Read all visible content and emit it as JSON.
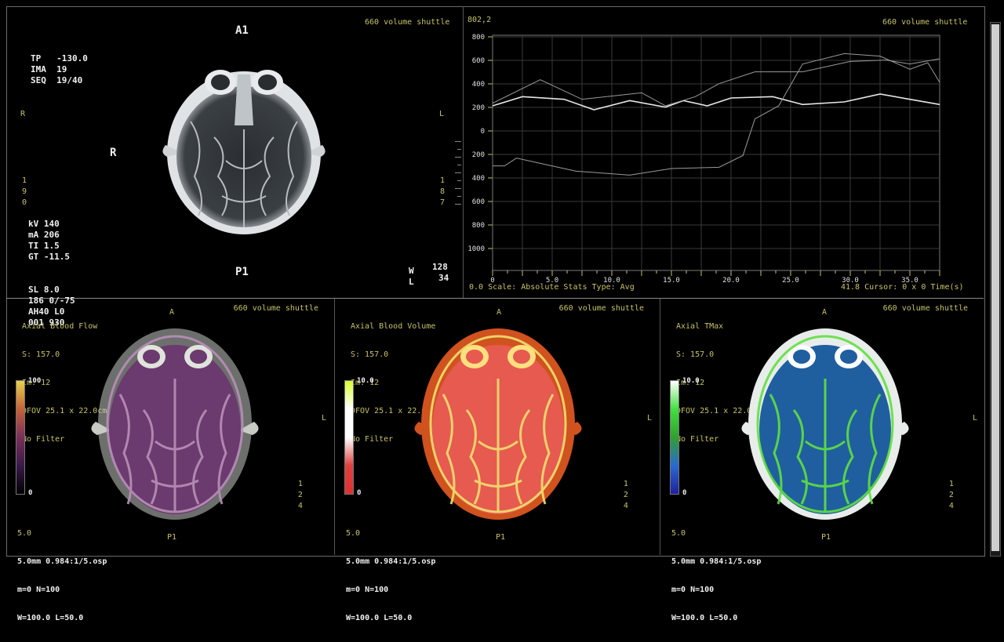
{
  "top_left": {
    "header": "660 volume shuttle",
    "view_top": "A1",
    "view_bottom": "P1",
    "side_r_small": "R",
    "side_r_big": "R",
    "side_l": "L",
    "left_numbers": [
      "1",
      "9",
      "0"
    ],
    "right_numbers": [
      "1",
      "8",
      "7"
    ],
    "info_top": [
      "TP   -130.0",
      "IMA  19",
      "SEQ  19/40"
    ],
    "info_bottom": [
      "kV 140",
      "mA 206",
      "TI 1.5",
      "GT -11.5",
      "SL 8.0",
      "186 0/-75",
      "AH40 L0",
      "001 930"
    ],
    "w_label": "W",
    "w_value": "128",
    "l_label": "L",
    "l_value": "34"
  },
  "graph": {
    "header": "660 volume shuttle",
    "corner": "802,2",
    "footer_left": "0.0 Scale: Absolute Stats Type: Avg",
    "footer_right": "41.8 Cursor: 0 x 0 Time(s)"
  },
  "chart_data": {
    "type": "line",
    "xlabel": "Time(s)",
    "x_ticks": [
      "0",
      "5.0",
      "10.0",
      "15.0",
      "20.0",
      "25.0",
      "30.0",
      "35.0"
    ],
    "y_ticks": [
      "800",
      "600",
      "400",
      "200",
      "0",
      "200",
      "400",
      "600",
      "800",
      "1000"
    ],
    "xlim": [
      0,
      37.5
    ],
    "ylim": [
      -1000,
      800
    ],
    "series": [
      {
        "values": [
          [
            0,
            260
          ],
          [
            2.5,
            330
          ],
          [
            6,
            310
          ],
          [
            8.5,
            230
          ],
          [
            11.5,
            300
          ],
          [
            14.5,
            250
          ],
          [
            16,
            300
          ],
          [
            18,
            260
          ],
          [
            20,
            320
          ],
          [
            23.5,
            330
          ],
          [
            26,
            270
          ],
          [
            29.5,
            290
          ],
          [
            32.5,
            350
          ],
          [
            35,
            310
          ],
          [
            37.5,
            270
          ]
        ]
      },
      {
        "values": [
          [
            0,
            280
          ],
          [
            4,
            460
          ],
          [
            7.5,
            310
          ],
          [
            12.5,
            360
          ],
          [
            14.5,
            260
          ],
          [
            17,
            330
          ],
          [
            19,
            430
          ],
          [
            22,
            520
          ],
          [
            26,
            520
          ],
          [
            30,
            600
          ],
          [
            33,
            610
          ],
          [
            35,
            580
          ],
          [
            37.5,
            620
          ]
        ]
      },
      {
        "values": [
          [
            0,
            -200
          ],
          [
            1,
            -200
          ],
          [
            2,
            -140
          ],
          [
            4,
            -180
          ],
          [
            7,
            -240
          ],
          [
            11.5,
            -270
          ],
          [
            15,
            -220
          ],
          [
            19,
            -210
          ],
          [
            21,
            -120
          ],
          [
            22,
            160
          ],
          [
            24,
            260
          ],
          [
            26,
            580
          ],
          [
            29.5,
            660
          ],
          [
            32.5,
            640
          ],
          [
            35,
            540
          ],
          [
            36.5,
            590
          ],
          [
            37.5,
            440
          ]
        ]
      }
    ]
  },
  "panels": [
    {
      "title": "Axial Blood Flow",
      "header": "660 volume shuttle",
      "s": "S: 157.0",
      "im": "Im: 12",
      "dfov": "DFOV 25.1 x 22.0cm",
      "filter": "No Filter",
      "scale_max": "100",
      "scale_min": "0",
      "top": "A",
      "bottom": "P1",
      "side": "L",
      "side_nums": [
        "1",
        "2",
        "4"
      ],
      "footer": [
        "5.0",
        "5.0mm 0.984:1/5.osp",
        "m=0 N=100",
        "W=100.0 L=50.0"
      ]
    },
    {
      "title": "Axial Blood Volume",
      "header": "660 volume shuttle",
      "s": "S: 157.0",
      "im": "Im: 12",
      "dfov": "DFOV 25.1 x 22.0cm",
      "filter": "No Filter",
      "scale_max": "10.0",
      "scale_min": "0",
      "top": "A",
      "bottom": "P1",
      "side": "L",
      "side_nums": [
        "1",
        "2",
        "4"
      ],
      "footer": [
        "5.0",
        "5.0mm 0.984:1/5.osp",
        "m=0 N=100",
        "W=100.0 L=50.0"
      ]
    },
    {
      "title": "Axial TMax",
      "header": "660 volume shuttle",
      "s": "S: 157.0",
      "im": "Im: 12",
      "dfov": "DFOV 25.1 x 22.0cm",
      "filter": "No Filter",
      "scale_max": "10.0",
      "scale_min": "0",
      "top": "A",
      "bottom": "P1",
      "side": "L",
      "side_nums": [
        "1",
        "2",
        "4"
      ],
      "footer": [
        "5.0",
        "5.0mm 0.984:1/5.osp",
        "m=0 N=100",
        "W=100.0 L=50.0"
      ]
    }
  ],
  "colors": {
    "accent_label": "#c8c266",
    "grid": "#3a3a3a",
    "series_main": "#e6e6e6",
    "series_dim": "#9a9a9a"
  }
}
